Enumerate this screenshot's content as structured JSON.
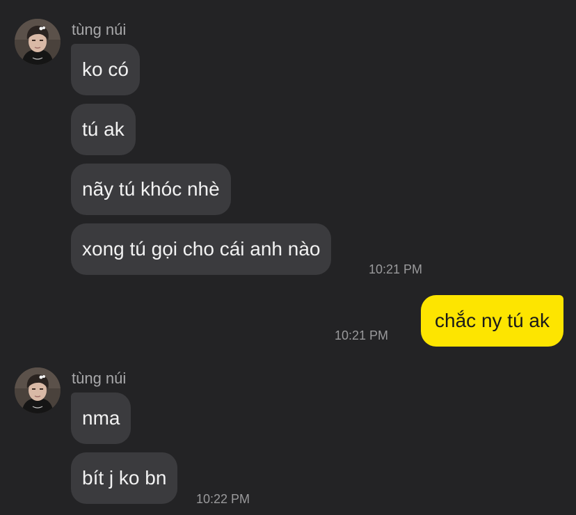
{
  "messages": [
    {
      "sender": "tùng núi",
      "lines": [
        "ko có",
        "tú ak",
        "nãy tú khóc nhè",
        "xong tú gọi cho cái anh nào"
      ],
      "time": "10:21 PM"
    },
    {
      "outgoing": true,
      "lines": [
        "chắc ny tú ak"
      ],
      "time": "10:21 PM"
    },
    {
      "sender": "tùng núi",
      "lines": [
        "nma",
        "bít j ko bn"
      ],
      "time": "10:22 PM"
    }
  ],
  "colors": {
    "background": "#232325",
    "incoming_bubble": "#3b3b3e",
    "outgoing_bubble": "#fde500",
    "sender_text": "#a9a9ab",
    "time_text": "#9a9a9c"
  }
}
